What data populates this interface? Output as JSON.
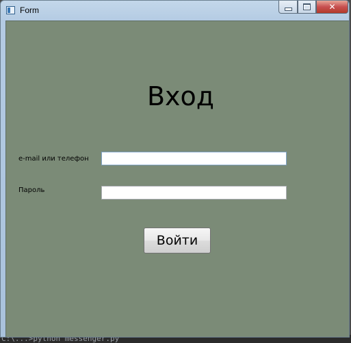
{
  "window": {
    "title": "Form",
    "controls": {
      "minimize_icon": "minimize-icon",
      "maximize_icon": "maximize-icon",
      "close_glyph": "✕"
    }
  },
  "form": {
    "heading": "Вход",
    "login_label": "e-mail или телефон",
    "login_value": "",
    "password_label": "Пароль",
    "password_value": "",
    "submit_label": "Войти"
  },
  "background": {
    "terminal_text": "C:\\...>python messenger.py"
  },
  "colors": {
    "form_background": "#7b8b77",
    "titlebar": "#b4cbe3",
    "close_button": "#c75050"
  }
}
